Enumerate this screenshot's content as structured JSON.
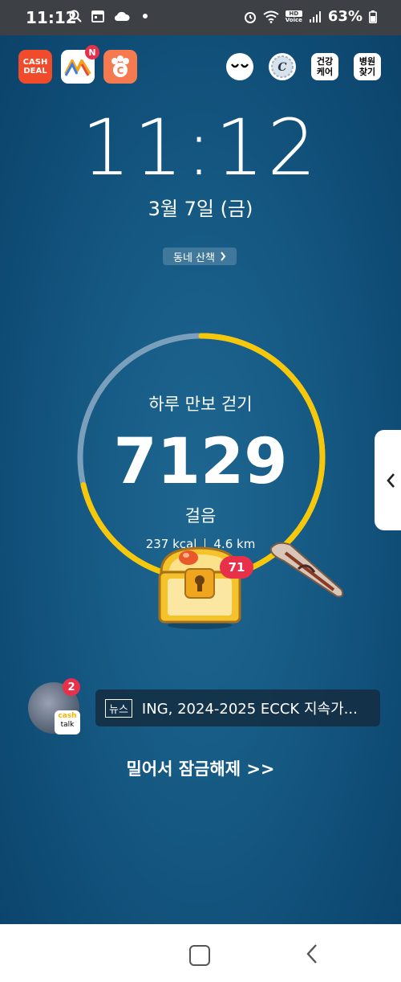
{
  "status_bar": {
    "time": "11:12",
    "battery": "63%",
    "hd_label": "HD",
    "voice_label": "Voice"
  },
  "apps": [
    {
      "name": "cash-deal",
      "label_line1": "CASH",
      "label_line2": "DEAL",
      "color": "#f04b2a"
    },
    {
      "name": "n-app",
      "badge": "N",
      "color": "#ffffff"
    },
    {
      "name": "paw-app",
      "label": "C",
      "color": "#f57a4f"
    }
  ],
  "top_right": {
    "health_care_line1": "건강",
    "health_care_line2": "케어",
    "hospital_line1": "병원",
    "hospital_line2": "찾기",
    "coin_label": "C"
  },
  "clock": {
    "time": "11:12",
    "date": "3월 7일 (금)"
  },
  "walk_button": {
    "label": "동네 산책"
  },
  "pedometer": {
    "title": "하루 만보 걷기",
    "steps": "7129",
    "unit": "걸음",
    "calories": "237 kcal",
    "distance": "4.6 km",
    "progress": 0.7129,
    "progress_color": "#f7c80a",
    "track_color": "#7a9fba"
  },
  "reward": {
    "count": "71"
  },
  "cash_talk": {
    "badge": "2",
    "label_line1": "cash",
    "label_line2": "talk"
  },
  "news": {
    "tag": "뉴스",
    "headline": "ING, 2024-2025 ECCK 지속가..."
  },
  "unlock": {
    "label": "밀어서 잠금해제 >>"
  }
}
